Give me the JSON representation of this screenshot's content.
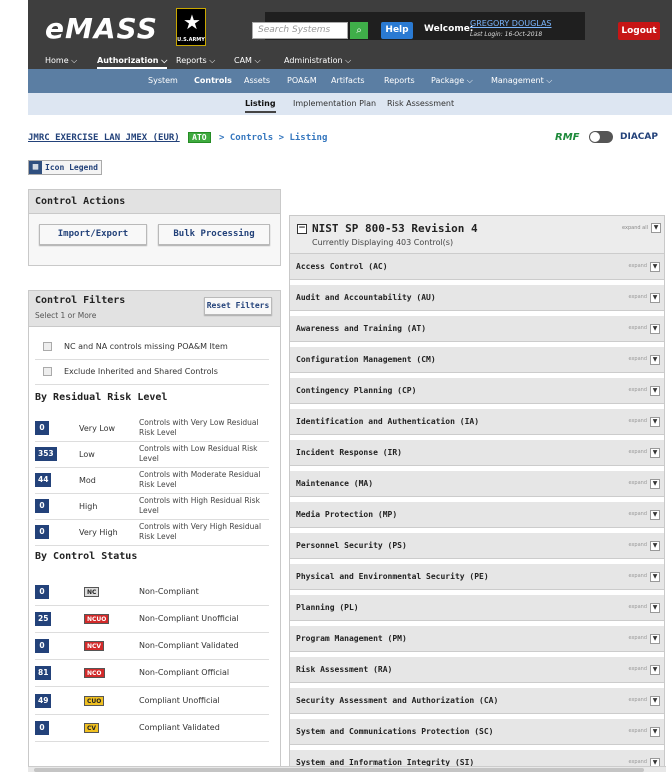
{
  "header": {
    "logo": "eMASS",
    "army_logo_text": "U.S.ARMY",
    "search_placeholder": "Search Systems",
    "help_label": "Help",
    "welcome_label": "Welcome:",
    "user_name": "GREGORY DOUGLAS",
    "last_login": "Last Login: 16-Oct-2018",
    "logout_label": "Logout"
  },
  "nav1": [
    {
      "label": "Home ⌵"
    },
    {
      "label": "Authorization ⌵"
    },
    {
      "label": "Reports ⌵"
    },
    {
      "label": "CAM ⌵"
    },
    {
      "label": "Administration ⌵"
    }
  ],
  "nav2": [
    {
      "label": "System"
    },
    {
      "label": "Controls"
    },
    {
      "label": "Assets"
    },
    {
      "label": "POA&M"
    },
    {
      "label": "Artifacts"
    },
    {
      "label": "Reports"
    },
    {
      "label": "Package ⌵"
    },
    {
      "label": "Management ⌵"
    }
  ],
  "nav3": [
    {
      "label": "Listing"
    },
    {
      "label": "Implementation Plan"
    },
    {
      "label": "Risk Assessment"
    }
  ],
  "breadcrumb": {
    "system": "JMRC EXERCISE LAN JMEX (EUR)",
    "ato": "ATO",
    "path": "> Controls > Listing"
  },
  "mode_toggle": {
    "rmf": "RMF",
    "diacap": "DIACAP"
  },
  "icon_legend": "Icon Legend",
  "control_actions": {
    "title": "Control Actions",
    "import_export": "Import/Export",
    "bulk_processing": "Bulk Processing"
  },
  "control_filters": {
    "title": "Control Filters",
    "subtitle": "Select 1 or More",
    "reset": "Reset Filters",
    "checks": [
      "NC and NA controls missing POA&M Item",
      "Exclude Inherited and Shared Controls"
    ],
    "risk_title": "By Residual Risk Level",
    "risk": [
      {
        "count": "0",
        "label": "Very Low",
        "desc": "Controls with Very Low Residual Risk Level"
      },
      {
        "count": "353",
        "label": "Low",
        "desc": "Controls with Low Residual Risk Level"
      },
      {
        "count": "44",
        "label": "Mod",
        "desc": "Controls with Moderate Residual Risk Level"
      },
      {
        "count": "0",
        "label": "High",
        "desc": "Controls with High Residual Risk Level"
      },
      {
        "count": "0",
        "label": "Very High",
        "desc": "Controls with Very High Residual Risk Level"
      }
    ],
    "status_title": "By Control Status",
    "status": [
      {
        "count": "0",
        "tag": "NC",
        "text": "Non-Compliant",
        "tag_bg": "#dddddd",
        "tag_fg": "#222222"
      },
      {
        "count": "25",
        "tag": "NCUO",
        "text": "Non-Compliant Unofficial",
        "tag_bg": "#d22a2a",
        "tag_fg": "#ffffff"
      },
      {
        "count": "0",
        "tag": "NCV",
        "text": "Non-Compliant Validated",
        "tag_bg": "#d22a2a",
        "tag_fg": "#ffffff"
      },
      {
        "count": "81",
        "tag": "NCO",
        "text": "Non-Compliant Official",
        "tag_bg": "#d22a2a",
        "tag_fg": "#ffffff"
      },
      {
        "count": "49",
        "tag": "CUO",
        "text": "Compliant Unofficial",
        "tag_bg": "#f0c020",
        "tag_fg": "#222222"
      },
      {
        "count": "0",
        "tag": "CV",
        "text": "Compliant Validated",
        "tag_bg": "#f0c020",
        "tag_fg": "#222222"
      }
    ]
  },
  "nist": {
    "title": "NIST SP 800-53 Revision 4",
    "subtitle": "Currently Displaying 403 Control(s)",
    "expand_all": "expand all",
    "expand": "expand",
    "families": [
      "Access Control (AC)",
      "Audit and Accountability (AU)",
      "Awareness and Training (AT)",
      "Configuration Management (CM)",
      "Contingency Planning (CP)",
      "Identification and Authentication (IA)",
      "Incident Response (IR)",
      "Maintenance (MA)",
      "Media Protection (MP)",
      "Personnel Security (PS)",
      "Physical and Environmental Security (PE)",
      "Planning (PL)",
      "Program Management (PM)",
      "Risk Assessment (RA)",
      "Security Assessment and Authorization (CA)",
      "System and Communications Protection (SC)",
      "System and Information Integrity (SI)"
    ]
  }
}
